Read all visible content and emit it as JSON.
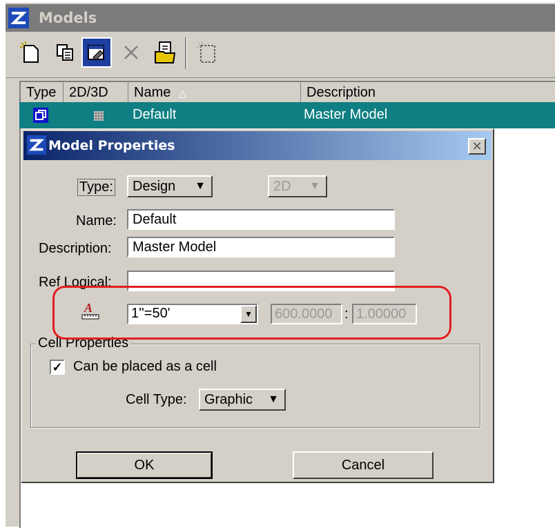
{
  "models_window": {
    "title": "Models",
    "toolbar": [
      {
        "name": "new-model-icon",
        "glyph": "🗋",
        "pressed": false
      },
      {
        "name": "copy-model-icon",
        "glyph": "⧉",
        "pressed": false
      },
      {
        "name": "model-properties-icon",
        "glyph": "🗗",
        "pressed": true
      },
      {
        "name": "delete-model-icon",
        "glyph": "✕",
        "pressed": false
      },
      {
        "name": "import-model-icon",
        "glyph": "📂",
        "pressed": false
      },
      {
        "name": "create-cell-icon",
        "glyph": "▢",
        "pressed": false
      }
    ],
    "columns": [
      "Type",
      "2D/3D",
      "Name",
      "Description"
    ],
    "sort_glyph": "△",
    "rows": [
      {
        "type_icon": "▣",
        "dim_icon": "▩",
        "name": "Default",
        "description": "Master Model"
      }
    ],
    "selected_row_color": "#0f7f83"
  },
  "dialog": {
    "title": "Model Properties",
    "close_glyph": "✕",
    "type_label": "Type:",
    "type_value": "Design",
    "dim_value": "2D",
    "name_label": "Name:",
    "name_value": "Default",
    "description_label": "Description:",
    "description_value": "Master Model",
    "ref_logical_label": "Ref Logical:",
    "ref_logical_value": "",
    "annotation_scale_icon": "annotation-scale-icon",
    "scale_value": "1''=50'",
    "scale_num": "600.0000",
    "scale_sep": ":",
    "scale_den": "1.00000",
    "cell_group_label": "Cell Properties",
    "can_place_cell_label": "Can be placed as a cell",
    "can_place_cell_checked": true,
    "cell_type_label": "Cell Type:",
    "cell_type_value": "Graphic",
    "ok_label": "OK",
    "cancel_label": "Cancel",
    "highlight_color": "#e21d1d"
  }
}
